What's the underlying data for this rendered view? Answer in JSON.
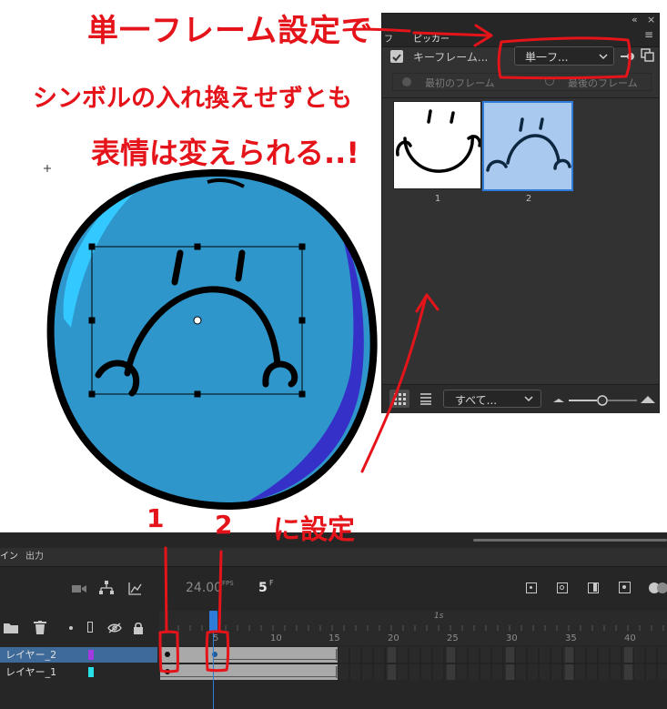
{
  "annotations": {
    "line1": "単一フレーム設定で",
    "line2": "シンボルの入れ換えせずとも",
    "line3": "表情は変えられる..!",
    "num1": "1",
    "num2": "2",
    "line4": "に設定"
  },
  "picker": {
    "tab_label": "ピッカー",
    "collapse_icon": "«",
    "close_icon": "×",
    "keyframe_label": "キーフレーム...",
    "loop_select_value": "単一フ...",
    "first_frame_label": "最初のフレーム",
    "last_frame_label": "最後のフレーム",
    "thumbnails": [
      {
        "label": "1",
        "selected": false
      },
      {
        "label": "2",
        "selected": true
      }
    ],
    "filter_select_value": "すべて...",
    "accent_color": "#2f7bd8",
    "selected_thumb_bg": "#a9c9ee"
  },
  "timeline": {
    "tabs": [
      "イン",
      "出力"
    ],
    "fps": "24.00",
    "fps_unit": "FPS",
    "current_frame": "5",
    "frame_unit": "F",
    "ruler_marks": [
      "5",
      "10",
      "15",
      "20",
      "25",
      "30",
      "35",
      "40"
    ],
    "ruler_second": "1s",
    "layers": [
      {
        "name": "レイヤー_2",
        "color": "#a33ae0",
        "selected": true
      },
      {
        "name": "レイヤー_1",
        "color": "#27e0e8",
        "selected": false
      }
    ]
  },
  "colors": {
    "ball_fill": "#2f96cc",
    "ball_highlight": "#33c8ff",
    "ball_shadow": "#3530c8",
    "annotation_red": "#e5141b"
  }
}
